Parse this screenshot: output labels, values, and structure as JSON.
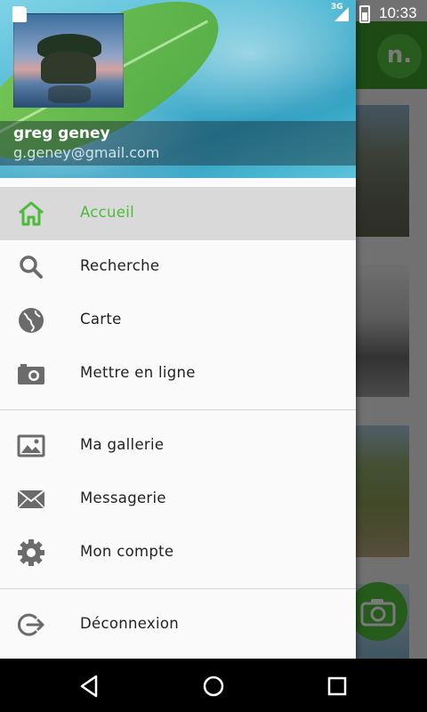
{
  "status_bar": {
    "network": "3G",
    "time": "10:33"
  },
  "background_app": {
    "logo_text": "n."
  },
  "drawer": {
    "user": {
      "name": "greg geney",
      "email": "g.geney@gmail.com"
    },
    "sections": [
      [
        {
          "label": "Accueil",
          "icon": "home-icon",
          "active": true
        },
        {
          "label": "Recherche",
          "icon": "search-icon",
          "active": false
        },
        {
          "label": "Carte",
          "icon": "globe-icon",
          "active": false
        },
        {
          "label": "Mettre en ligne",
          "icon": "camera-icon",
          "active": false
        }
      ],
      [
        {
          "label": "Ma gallerie",
          "icon": "image-icon",
          "active": false
        },
        {
          "label": "Messagerie",
          "icon": "mail-icon",
          "active": false
        },
        {
          "label": "Mon compte",
          "icon": "gear-icon",
          "active": false
        }
      ],
      [
        {
          "label": "Déconnexion",
          "icon": "logout-icon",
          "active": false
        }
      ]
    ]
  },
  "colors": {
    "accent": "#4cbb3a",
    "toolbar": "#3e9a2c",
    "icon_gray": "#6b6b6b"
  }
}
